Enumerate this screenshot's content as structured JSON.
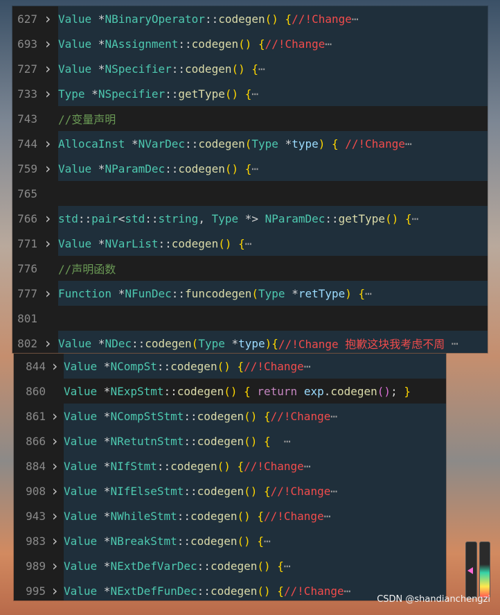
{
  "top_lines": [
    {
      "n": "627",
      "fold": true,
      "tokens": [
        [
          "kw",
          "Value "
        ],
        [
          "ptr",
          "*"
        ],
        [
          "cls",
          "NBinaryOperator"
        ],
        [
          "op",
          "::"
        ],
        [
          "fn",
          "codegen"
        ],
        [
          "br1",
          "() {"
        ],
        [
          "cm-red",
          "//!Change"
        ],
        [
          "ell",
          "⋯"
        ]
      ]
    },
    {
      "n": "693",
      "fold": true,
      "tokens": [
        [
          "kw",
          "Value "
        ],
        [
          "ptr",
          "*"
        ],
        [
          "cls",
          "NAssignment"
        ],
        [
          "op",
          "::"
        ],
        [
          "fn",
          "codegen"
        ],
        [
          "br1",
          "() {"
        ],
        [
          "cm-red",
          "//!Change"
        ],
        [
          "ell",
          "⋯"
        ]
      ]
    },
    {
      "n": "727",
      "fold": true,
      "tokens": [
        [
          "kw",
          "Value "
        ],
        [
          "ptr",
          "*"
        ],
        [
          "cls",
          "NSpecifier"
        ],
        [
          "op",
          "::"
        ],
        [
          "fn",
          "codegen"
        ],
        [
          "br1",
          "() {"
        ],
        [
          "ell",
          "⋯"
        ]
      ]
    },
    {
      "n": "733",
      "fold": true,
      "tokens": [
        [
          "kw",
          "Type "
        ],
        [
          "ptr",
          "*"
        ],
        [
          "cls",
          "NSpecifier"
        ],
        [
          "op",
          "::"
        ],
        [
          "fn",
          "getType"
        ],
        [
          "br1",
          "() {"
        ],
        [
          "ell",
          "⋯"
        ]
      ]
    },
    {
      "n": "743",
      "fold": false,
      "tokens": [
        [
          "cm-green",
          "//变量声明"
        ]
      ]
    },
    {
      "n": "744",
      "fold": true,
      "tokens": [
        [
          "kw",
          "AllocaInst "
        ],
        [
          "ptr",
          "*"
        ],
        [
          "cls",
          "NVarDec"
        ],
        [
          "op",
          "::"
        ],
        [
          "fn",
          "codegen"
        ],
        [
          "br1",
          "("
        ],
        [
          "kw",
          "Type "
        ],
        [
          "ptr",
          "*"
        ],
        [
          "var",
          "type"
        ],
        [
          "br1",
          ") { "
        ],
        [
          "cm-red",
          "//!Change"
        ],
        [
          "ell",
          "⋯"
        ]
      ]
    },
    {
      "n": "759",
      "fold": true,
      "tokens": [
        [
          "kw",
          "Value "
        ],
        [
          "ptr",
          "*"
        ],
        [
          "cls",
          "NParamDec"
        ],
        [
          "op",
          "::"
        ],
        [
          "fn",
          "codegen"
        ],
        [
          "br1",
          "() {"
        ],
        [
          "ell",
          "⋯"
        ]
      ]
    },
    {
      "n": "765",
      "fold": false,
      "tokens": []
    },
    {
      "n": "766",
      "fold": true,
      "tokens": [
        [
          "std",
          "std"
        ],
        [
          "op",
          "::"
        ],
        [
          "std",
          "pair"
        ],
        [
          "pun",
          "<"
        ],
        [
          "std",
          "std"
        ],
        [
          "op",
          "::"
        ],
        [
          "std",
          "string"
        ],
        [
          "pun",
          ", "
        ],
        [
          "kw",
          "Type "
        ],
        [
          "ptr",
          "*"
        ],
        [
          "pun",
          "> "
        ],
        [
          "cls",
          "NParamDec"
        ],
        [
          "op",
          "::"
        ],
        [
          "fn",
          "getType"
        ],
        [
          "br1",
          "() {"
        ],
        [
          "ell",
          "⋯"
        ]
      ]
    },
    {
      "n": "771",
      "fold": true,
      "tokens": [
        [
          "kw",
          "Value "
        ],
        [
          "ptr",
          "*"
        ],
        [
          "cls",
          "NVarList"
        ],
        [
          "op",
          "::"
        ],
        [
          "fn",
          "codegen"
        ],
        [
          "br1",
          "() {"
        ],
        [
          "ell",
          "⋯"
        ]
      ]
    },
    {
      "n": "776",
      "fold": false,
      "tokens": [
        [
          "cm-green",
          "//声明函数"
        ]
      ]
    },
    {
      "n": "777",
      "fold": true,
      "tokens": [
        [
          "kw",
          "Function "
        ],
        [
          "ptr",
          "*"
        ],
        [
          "cls",
          "NFunDec"
        ],
        [
          "op",
          "::"
        ],
        [
          "fn",
          "funcodegen"
        ],
        [
          "br1",
          "("
        ],
        [
          "kw",
          "Type "
        ],
        [
          "ptr",
          "*"
        ],
        [
          "var",
          "retType"
        ],
        [
          "br1",
          ") {"
        ],
        [
          "ell",
          "⋯"
        ]
      ]
    },
    {
      "n": "801",
      "fold": false,
      "tokens": []
    },
    {
      "n": "802",
      "fold": true,
      "tokens": [
        [
          "kw",
          "Value "
        ],
        [
          "ptr",
          "*"
        ],
        [
          "cls",
          "NDec"
        ],
        [
          "op",
          "::"
        ],
        [
          "fn",
          "codegen"
        ],
        [
          "br1",
          "("
        ],
        [
          "kw",
          "Type "
        ],
        [
          "ptr",
          "*"
        ],
        [
          "var",
          "type"
        ],
        [
          "br1",
          "){"
        ],
        [
          "cm-red",
          "//!Change 抱歉这块我考虑不周"
        ],
        [
          "ell",
          " ⋯"
        ]
      ]
    }
  ],
  "bottom_lines": [
    {
      "n": "844",
      "fold": true,
      "tokens": [
        [
          "kw",
          "Value "
        ],
        [
          "ptr",
          "*"
        ],
        [
          "cls",
          "NCompSt"
        ],
        [
          "op",
          "::"
        ],
        [
          "fn",
          "codegen"
        ],
        [
          "br1",
          "() {"
        ],
        [
          "cm-red",
          "//!Change"
        ],
        [
          "ell",
          "⋯"
        ]
      ]
    },
    {
      "n": "860",
      "fold": false,
      "tokens": [
        [
          "kw",
          "Value "
        ],
        [
          "ptr",
          "*"
        ],
        [
          "cls",
          "NExpStmt"
        ],
        [
          "op",
          "::"
        ],
        [
          "fn",
          "codegen"
        ],
        [
          "br1",
          "() { "
        ],
        [
          "ret",
          "return "
        ],
        [
          "var",
          "exp"
        ],
        [
          "pun",
          "."
        ],
        [
          "fn",
          "codegen"
        ],
        [
          "br2",
          "()"
        ],
        [
          "pun",
          "; "
        ],
        [
          "br1",
          "}"
        ]
      ]
    },
    {
      "n": "861",
      "fold": true,
      "tokens": [
        [
          "kw",
          "Value "
        ],
        [
          "ptr",
          "*"
        ],
        [
          "cls",
          "NCompStStmt"
        ],
        [
          "op",
          "::"
        ],
        [
          "fn",
          "codegen"
        ],
        [
          "br1",
          "() {"
        ],
        [
          "cm-red",
          "//!Change"
        ],
        [
          "ell",
          "⋯"
        ]
      ]
    },
    {
      "n": "866",
      "fold": true,
      "tokens": [
        [
          "kw",
          "Value "
        ],
        [
          "ptr",
          "*"
        ],
        [
          "cls",
          "NRetutnStmt"
        ],
        [
          "op",
          "::"
        ],
        [
          "fn",
          "codegen"
        ],
        [
          "br1",
          "() {  "
        ],
        [
          "ell",
          "⋯"
        ]
      ]
    },
    {
      "n": "884",
      "fold": true,
      "tokens": [
        [
          "kw",
          "Value "
        ],
        [
          "ptr",
          "*"
        ],
        [
          "cls",
          "NIfStmt"
        ],
        [
          "op",
          "::"
        ],
        [
          "fn",
          "codegen"
        ],
        [
          "br1",
          "() {"
        ],
        [
          "cm-red",
          "//!Change"
        ],
        [
          "ell",
          "⋯"
        ]
      ]
    },
    {
      "n": "908",
      "fold": true,
      "tokens": [
        [
          "kw",
          "Value "
        ],
        [
          "ptr",
          "*"
        ],
        [
          "cls",
          "NIfElseStmt"
        ],
        [
          "op",
          "::"
        ],
        [
          "fn",
          "codegen"
        ],
        [
          "br1",
          "() {"
        ],
        [
          "cm-red",
          "//!Change"
        ],
        [
          "ell",
          "⋯"
        ]
      ]
    },
    {
      "n": "943",
      "fold": true,
      "tokens": [
        [
          "kw",
          "Value "
        ],
        [
          "ptr",
          "*"
        ],
        [
          "cls",
          "NWhileStmt"
        ],
        [
          "op",
          "::"
        ],
        [
          "fn",
          "codegen"
        ],
        [
          "br1",
          "() {"
        ],
        [
          "cm-red",
          "//!Change"
        ],
        [
          "ell",
          "⋯"
        ]
      ]
    },
    {
      "n": "983",
      "fold": true,
      "tokens": [
        [
          "kw",
          "Value "
        ],
        [
          "ptr",
          "*"
        ],
        [
          "cls",
          "NBreakStmt"
        ],
        [
          "op",
          "::"
        ],
        [
          "fn",
          "codegen"
        ],
        [
          "br1",
          "() {"
        ],
        [
          "ell",
          "⋯"
        ]
      ]
    },
    {
      "n": "989",
      "fold": true,
      "tokens": [
        [
          "kw",
          "Value "
        ],
        [
          "ptr",
          "*"
        ],
        [
          "cls",
          "NExtDefVarDec"
        ],
        [
          "op",
          "::"
        ],
        [
          "fn",
          "codegen"
        ],
        [
          "br1",
          "() {"
        ],
        [
          "ell",
          "⋯"
        ]
      ]
    },
    {
      "n": "995",
      "fold": true,
      "tokens": [
        [
          "kw",
          "Value "
        ],
        [
          "ptr",
          "*"
        ],
        [
          "cls",
          "NExtDefFunDec"
        ],
        [
          "op",
          "::"
        ],
        [
          "fn",
          "codegen"
        ],
        [
          "br1",
          "() {"
        ],
        [
          "cm-red",
          "//!Change"
        ],
        [
          "ell",
          "⋯"
        ]
      ]
    }
  ],
  "watermark": "CSDN @shandianchengzi",
  "icons": {
    "fold": "chevron-right-icon"
  }
}
